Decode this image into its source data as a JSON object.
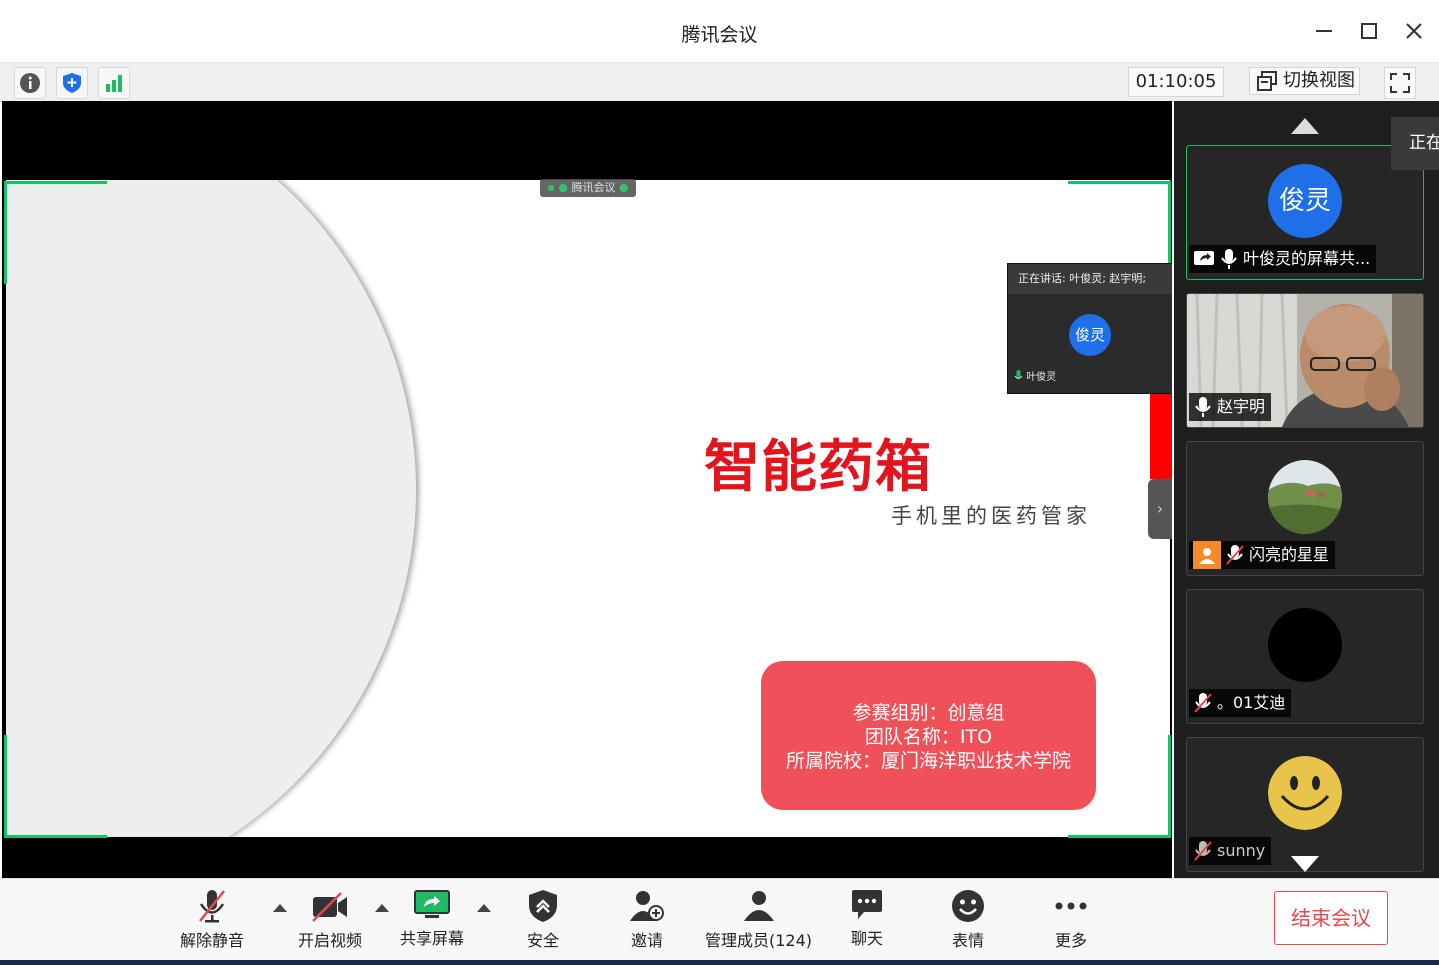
{
  "window": {
    "title": "腾讯会议",
    "minimize_glyph": "—",
    "maximize_glyph": "☐",
    "close_glyph": "✕"
  },
  "toolbar": {
    "timer": "01:10:05",
    "switch_view_label": "切换视图",
    "icons": [
      "info-icon",
      "security-shield-icon",
      "signal-icon",
      "switch-view-icon",
      "fullscreen-icon"
    ]
  },
  "stage": {
    "share_label": "腾讯会议",
    "slide": {
      "title": "智能药箱",
      "subtitle": "手机里的医药管家",
      "info_lines": [
        "参赛组别：创意组",
        "团队名称：ITO",
        "所属院校：厦门海洋职业技术学院"
      ]
    },
    "speaker_panel": {
      "header": "正在讲话: 叶俊灵; 赵宇明;",
      "avatar_text": "俊灵",
      "name": "叶俊灵"
    },
    "collapse_glyph": "›"
  },
  "side_tab_text": "正在",
  "participants": [
    {
      "avatar_text": "俊灵",
      "name": "叶俊灵的屏幕共...",
      "mic": "on",
      "sharing": true,
      "active": true,
      "avatar_type": "initials",
      "avatar_color": "#1e6fe8"
    },
    {
      "avatar_text": "",
      "name": "赵宇明",
      "mic": "on",
      "sharing": false,
      "active": false,
      "avatar_type": "video"
    },
    {
      "avatar_text": "",
      "name": "闪亮的星星",
      "mic": "muted",
      "sharing": false,
      "active": false,
      "avatar_type": "landscape",
      "host_badge": true
    },
    {
      "avatar_text": "",
      "name": "。01艾迪",
      "mic": "muted",
      "sharing": false,
      "active": false,
      "avatar_type": "black"
    },
    {
      "avatar_text": "",
      "name": "sunny",
      "mic": "muted",
      "sharing": false,
      "active": false,
      "avatar_type": "smiley"
    }
  ],
  "controls": {
    "unmute": "解除静音",
    "video": "开启视频",
    "share": "共享屏幕",
    "security": "安全",
    "invite": "邀请",
    "manage": "管理成员(124)",
    "chat": "聊天",
    "reactions": "表情",
    "more": "更多",
    "end": "结束会议"
  },
  "colors": {
    "accent_green": "#15c26b",
    "title_red": "#e2141c",
    "box_red": "#f05058",
    "end_red": "#e5484d",
    "avatar_blue": "#1e6fe8"
  }
}
